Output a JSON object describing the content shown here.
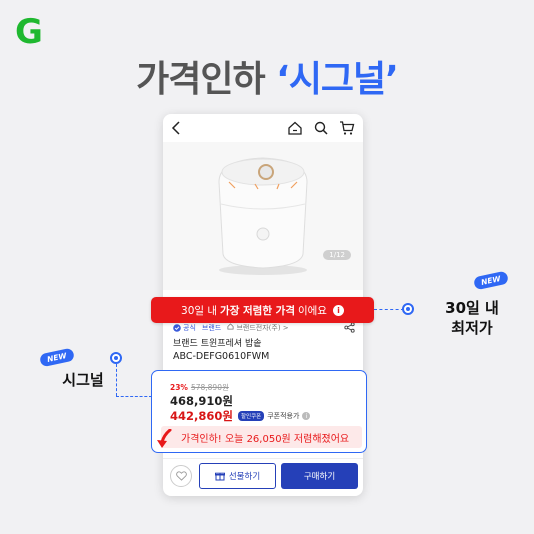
{
  "brand": {
    "logo_letter": "G",
    "logo_color": "#1fb82f"
  },
  "headline": {
    "prefix": "가격인하 ",
    "highlight": "‘시그널’"
  },
  "screen": {
    "icons": [
      "back-arrow-icon",
      "home-icon",
      "search-icon",
      "cart-icon"
    ],
    "image_pager": "1/12",
    "lowest_price_banner": {
      "pre": "30일 내 ",
      "bold": "가장 저렴한 가격",
      "post": "이에요"
    },
    "product": {
      "tag_official": "공식",
      "tag_brand": "브랜드",
      "seller": "브랜드전자(주) >",
      "name": "브랜드 트윈프레셔 밥솥",
      "code": "ABC-DEFG0610FWM"
    },
    "price": {
      "discount": "23%",
      "original": "578,890원",
      "sale": "468,910원",
      "coupon_price": "442,860원",
      "coupon_badge": "할인쿠폰",
      "coupon_label": "쿠폰적용가",
      "price_drop_message": "가격인하! 오늘 26,050원 저렴해졌어요"
    },
    "buttons": {
      "gift": "선물하기",
      "buy": "구매하기"
    }
  },
  "callouts": {
    "right": {
      "badge": "NEW",
      "line1": "30일 내",
      "line2": "최저가"
    },
    "left": {
      "badge": "NEW",
      "text": "시그널"
    }
  },
  "colors": {
    "accent_blue": "#2f68f4",
    "button_navy": "#2540b8",
    "alert_red": "#e8191b"
  }
}
